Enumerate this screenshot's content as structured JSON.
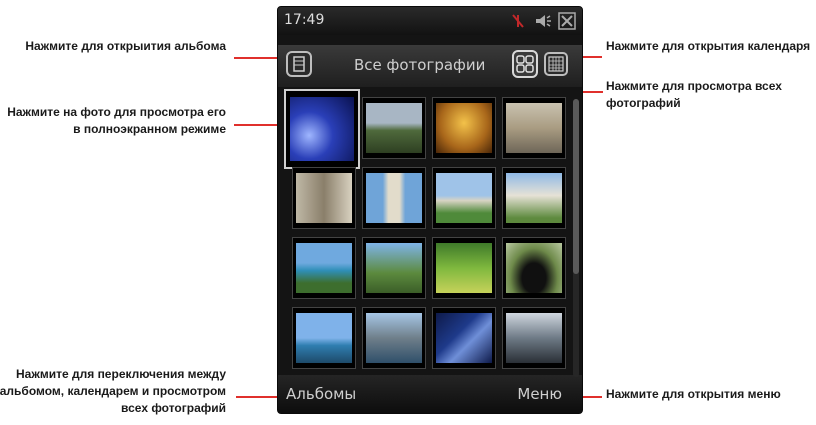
{
  "callouts": {
    "open_album": "Нажмите для открыития альбома",
    "view_fullscreen_line1": "Нажмите на фото для просмотра его",
    "view_fullscreen_line2": "в полноэкранном режиме",
    "switch_line1": "Нажмите для переключения между",
    "switch_line2": "альбомом, календарем и просмотром",
    "switch_line3": "всех фотографий",
    "open_calendar": "Нажмите для открытия календаря",
    "view_all_line1": "Нажмите для просмотра всех",
    "view_all_line2": "фотографий",
    "open_menu": "Нажмите для открытия меню"
  },
  "status_bar": {
    "time": "17:49"
  },
  "title_bar": {
    "title": "Все фотографии"
  },
  "softkeys": {
    "left": "Альбомы",
    "right": "Меню"
  },
  "icons": [
    "album-icon",
    "all-photos-grid-icon",
    "calendar-icon",
    "signal-icon",
    "speaker-icon",
    "close-icon"
  ],
  "colors": {
    "callout_line": "#e0302c",
    "device_bg": "#141414"
  }
}
